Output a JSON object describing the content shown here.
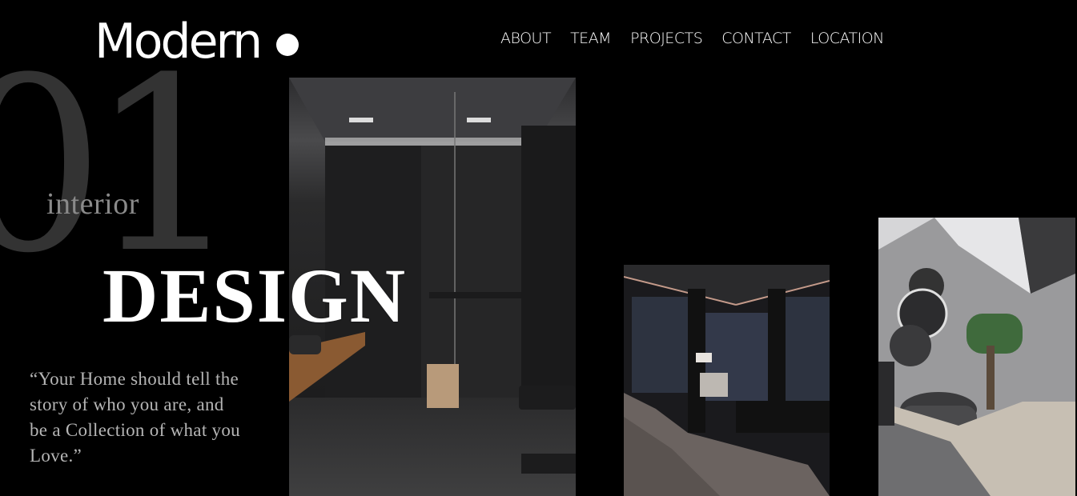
{
  "brand": {
    "logo_text": "Modern"
  },
  "nav": {
    "items": [
      {
        "label": "ABOUT"
      },
      {
        "label": "TEAM"
      },
      {
        "label": "PROJECTS"
      },
      {
        "label": "CONTACT"
      },
      {
        "label": "LOCATION"
      }
    ]
  },
  "hero": {
    "number": "01",
    "subtitle": "interior",
    "title": "DESIGN",
    "quote": "“Your Home should tell the story of who you are,  and be a Collection of what you Love.”"
  },
  "colors": {
    "background": "#000000",
    "text": "#ffffff",
    "number": "#333333",
    "subtitle": "#8a8a8a",
    "quote": "#b5b5b5"
  }
}
